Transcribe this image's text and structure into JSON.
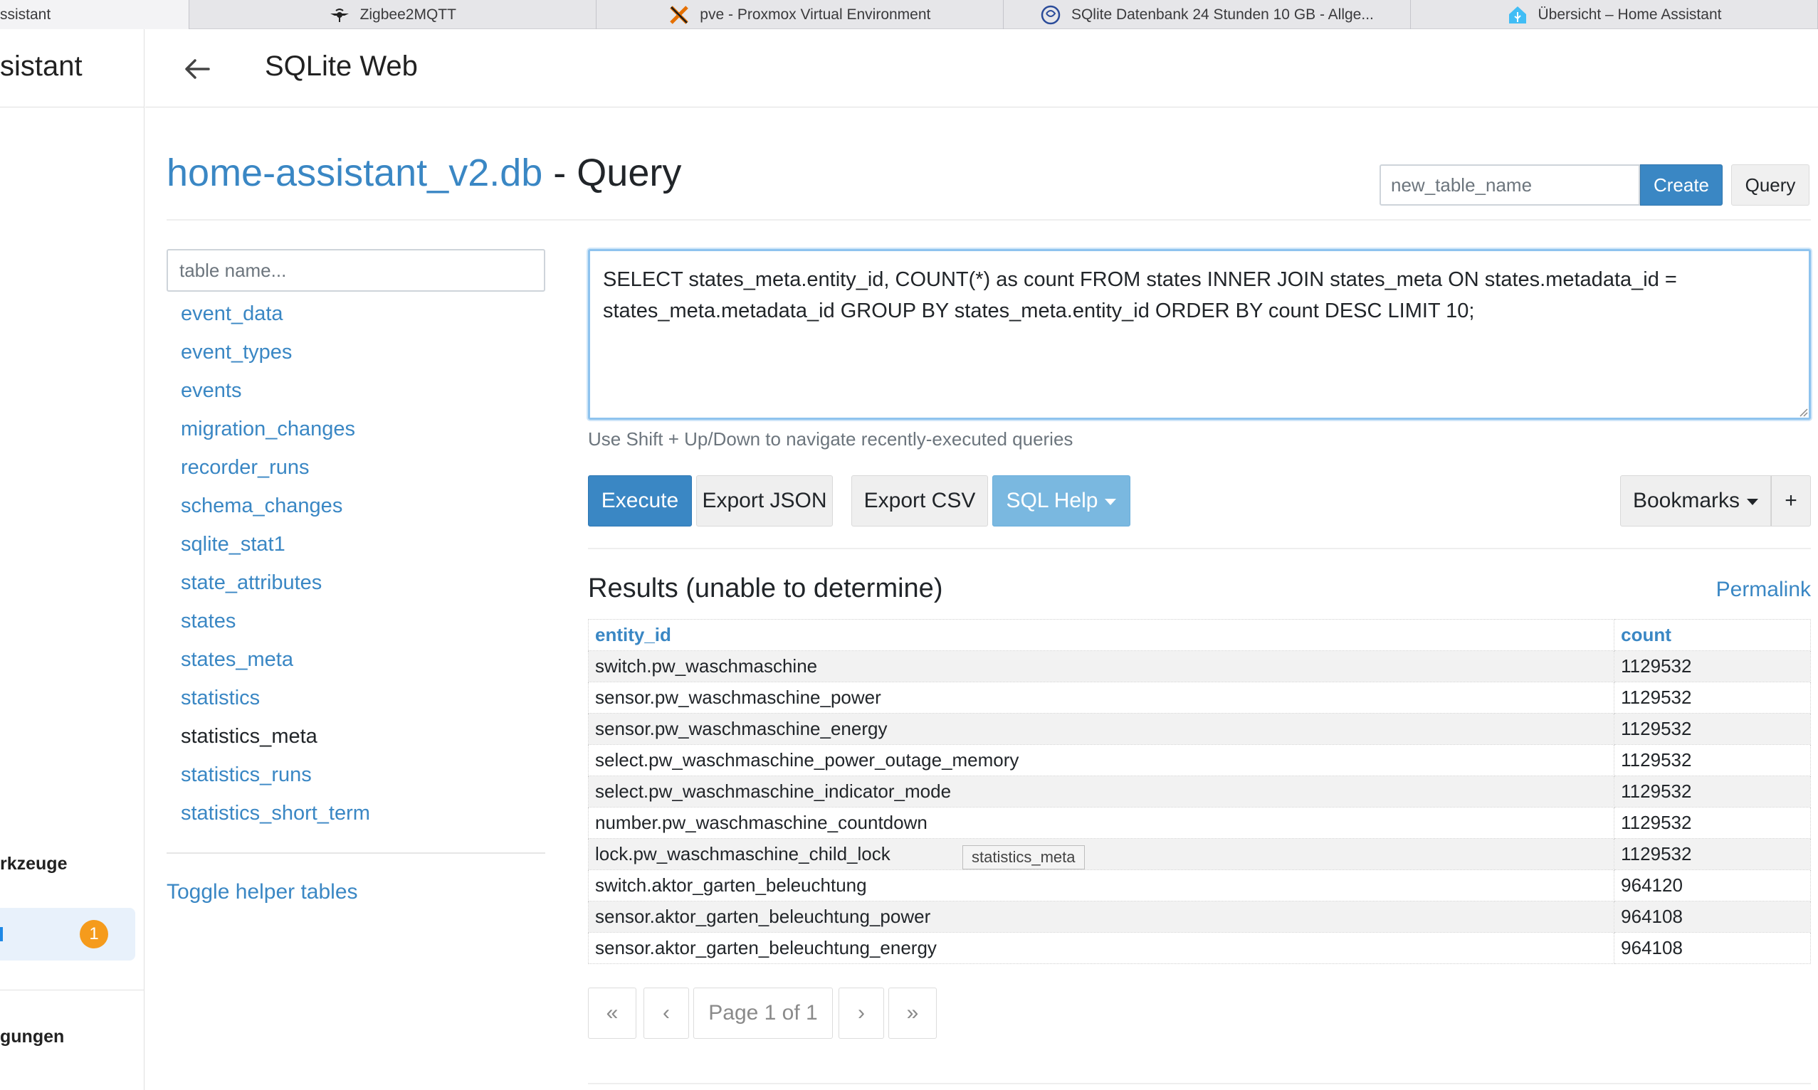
{
  "browser": {
    "tabs": [
      {
        "label": "ssistant",
        "icon": "home-assistant-icon"
      },
      {
        "label": "Zigbee2MQTT",
        "icon": "bee-icon"
      },
      {
        "label": "pve - Proxmox Virtual Environment",
        "icon": "proxmox-icon"
      },
      {
        "label": "SQlite Datenbank 24 Stunden 10 GB - Allge...",
        "icon": "forum-icon"
      },
      {
        "label": "Übersicht – Home Assistant",
        "icon": "home-assistant-icon"
      }
    ]
  },
  "ha_sidebar": {
    "title": "sistant",
    "section_tools": "rkzeuge",
    "active_item_label": "n",
    "active_item_badge": "1",
    "section_settings": "gungen"
  },
  "topbar": {
    "title": "SQLite Web"
  },
  "page": {
    "db_name": "home-assistant_v2.db",
    "separator": " - ",
    "section": "Query",
    "new_table_placeholder": "new_table_name",
    "create_label": "Create",
    "query_label": "Query"
  },
  "tables": {
    "filter_placeholder": "table name...",
    "items": [
      "event_data",
      "event_types",
      "events",
      "migration_changes",
      "recorder_runs",
      "schema_changes",
      "sqlite_stat1",
      "state_attributes",
      "states",
      "states_meta",
      "statistics",
      "statistics_meta",
      "statistics_runs",
      "statistics_short_term"
    ],
    "hovered_item": "statistics_meta",
    "toggle_helper": "Toggle helper tables"
  },
  "query": {
    "sql": "SELECT states_meta.entity_id, COUNT(*) as count FROM states INNER JOIN states_meta ON states.metadata_id = states_meta.metadata_id GROUP BY states_meta.entity_id ORDER BY count DESC LIMIT 10;",
    "help_text": "Use Shift + Up/Down to navigate recently-executed queries",
    "execute": "Execute",
    "export_json": "Export JSON",
    "export_csv": "Export CSV",
    "sql_help": "SQL Help",
    "bookmarks": "Bookmarks",
    "add_bookmark": "+"
  },
  "results": {
    "heading": "Results (unable to determine)",
    "permalink": "Permalink",
    "columns": [
      "entity_id",
      "count"
    ],
    "rows": [
      [
        "switch.pw_waschmaschine",
        "1129532"
      ],
      [
        "sensor.pw_waschmaschine_power",
        "1129532"
      ],
      [
        "sensor.pw_waschmaschine_energy",
        "1129532"
      ],
      [
        "select.pw_waschmaschine_power_outage_memory",
        "1129532"
      ],
      [
        "select.pw_waschmaschine_indicator_mode",
        "1129532"
      ],
      [
        "number.pw_waschmaschine_countdown",
        "1129532"
      ],
      [
        "lock.pw_waschmaschine_child_lock",
        "1129532"
      ],
      [
        "switch.aktor_garten_beleuchtung",
        "964120"
      ],
      [
        "sensor.aktor_garten_beleuchtung_power",
        "964108"
      ],
      [
        "sensor.aktor_garten_beleuchtung_energy",
        "964108"
      ]
    ],
    "tooltip": "statistics_meta"
  },
  "pagination": {
    "first": "«",
    "prev": "‹",
    "label": "Page 1 of 1",
    "next": "›",
    "last": "»"
  }
}
